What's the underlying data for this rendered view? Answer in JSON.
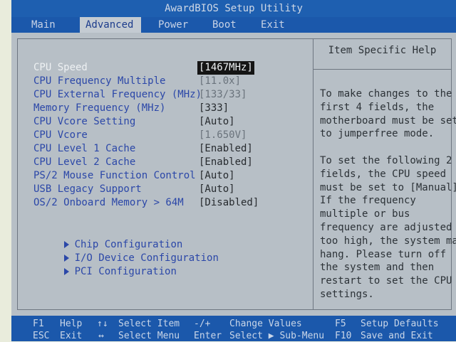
{
  "title": "AwardBIOS Setup Utility",
  "menu": [
    "Main",
    "Advanced",
    "Power",
    "Boot",
    "Exit"
  ],
  "settings": [
    {
      "label": "CPU Speed",
      "value": "[1467MHz]"
    },
    {
      "label": "CPU Frequency Multiple",
      "value": "[11.0x]"
    },
    {
      "label": "CPU External Frequency (MHz)",
      "value": "[133/33]"
    },
    {
      "label": "Memory Frequency (MHz)",
      "value": "[333]"
    },
    {
      "label": "CPU Vcore Setting",
      "value": "[Auto]"
    },
    {
      "label": "CPU Vcore",
      "value": "[1.650V]"
    },
    {
      "label": "CPU Level 1 Cache",
      "value": "[Enabled]"
    },
    {
      "label": "CPU Level 2 Cache",
      "value": "[Enabled]"
    },
    {
      "label": "PS/2 Mouse Function Control",
      "value": "[Auto]"
    },
    {
      "label": "USB Legacy Support",
      "value": "[Auto]"
    },
    {
      "label": "OS/2 Onboard Memory > 64M",
      "value": "[Disabled]"
    }
  ],
  "submenus": [
    "Chip Configuration",
    "I/O Device Configuration",
    "PCI Configuration"
  ],
  "help": {
    "title": "Item Specific Help",
    "text": "To make changes to the\nfirst 4 fields, the\nmotherboard must be set\nto jumperfree mode.\n\nTo set the following 2\nfields, the CPU speed\nmust be set to [Manual].\nIf the frequency\nmultiple or bus\nfrequency are adjusted\ntoo high, the system may\nhang. Please turn off\nthe system and then\nrestart to set the CPU\nsettings."
  },
  "keys": {
    "f1": "F1",
    "f1_label": "Help",
    "arrows_ud": "↑↓",
    "arrows_ud_label": "Select Item",
    "minus_plus": "-/+",
    "minus_plus_label": "Change Values",
    "f5": "F5",
    "f5_label": "Setup Defaults",
    "esc": "ESC",
    "esc_label": "Exit",
    "arrows_lr": "↔",
    "arrows_lr_label": "Select Menu",
    "enter": "Enter",
    "enter_label": "Select ▶ Sub-Menu",
    "f10": "F10",
    "f10_label": "Save and Exit"
  }
}
